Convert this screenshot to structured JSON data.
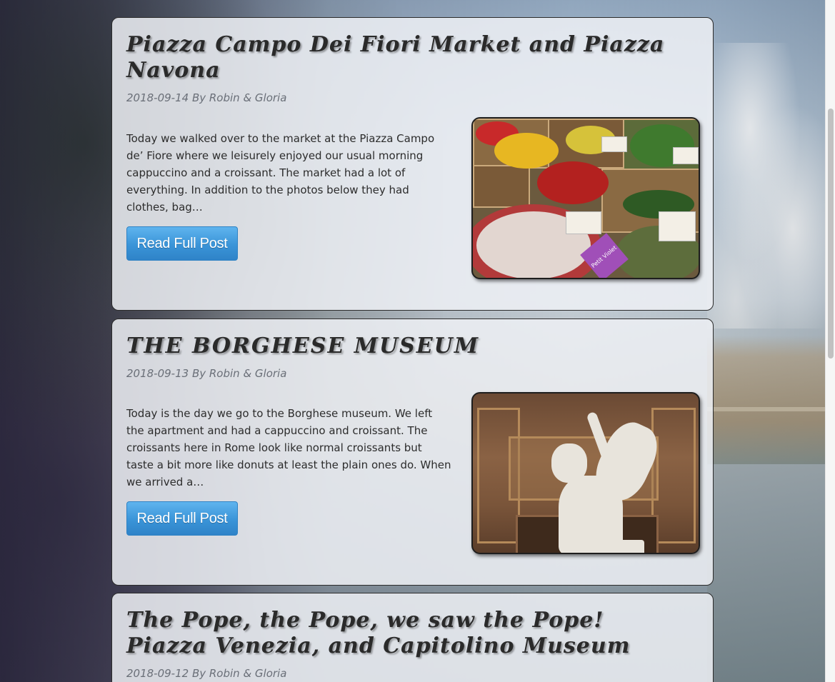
{
  "posts": [
    {
      "title": "Piazza Campo Dei Fiori Market and Piazza Navona",
      "meta": "2018-09-14 By Robin & Gloria",
      "excerpt": "Today we walked over to the market at the Piazza Campo de’ Fiore where we leisurely enjoyed our usual morning cappuccino and a croissant. The market had a lot of  everything. In addition to the photos below they had clothes, bag…",
      "button": "Read Full Post",
      "image": "market-photo"
    },
    {
      "title": "THE BORGHESE MUSEUM",
      "meta": "2018-09-13 By Robin & Gloria",
      "excerpt": "Today is the day we go to the Borghese museum. We left the apartment and had a cappuccino and croissant. The croissants here in Rome look like normal croissants but taste a bit more like donuts at least the plain ones do. When we arrived a…",
      "button": "Read Full Post",
      "image": "sculpture-photo"
    },
    {
      "title": "The Pope, the Pope, we saw the Pope! Piazza Venezia, and Capitolino Museum",
      "meta": "2018-09-12 By Robin & Gloria"
    }
  ],
  "photo_labels": {
    "market_sign": "Petit Violet"
  },
  "colors": {
    "button_top": "#5fb4ee",
    "button_bottom": "#2f83c8",
    "card_bg": "#eef0f4",
    "title": "#2a2a2a",
    "meta": "#6a6f78"
  }
}
